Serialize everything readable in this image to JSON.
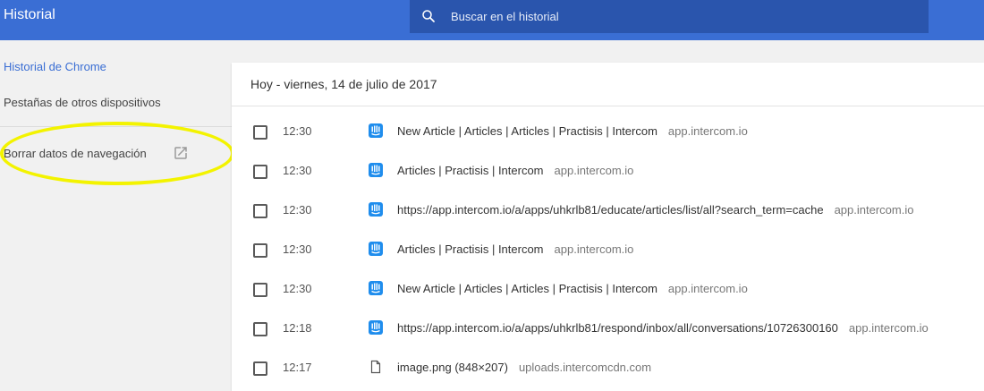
{
  "header": {
    "title": "Historial",
    "search_placeholder": "Buscar en el historial"
  },
  "sidebar": {
    "items": [
      {
        "label": "Historial de Chrome",
        "active": true
      },
      {
        "label": "Pestañas de otros dispositivos"
      },
      {
        "label": "Borrar datos de navegación"
      }
    ]
  },
  "history": {
    "date_header": "Hoy - viernes, 14 de julio de 2017",
    "entries": [
      {
        "time": "12:30",
        "title": "New Article | Articles | Articles | Practisis | Intercom",
        "domain": "app.intercom.io",
        "icon": "intercom-icon"
      },
      {
        "time": "12:30",
        "title": "Articles | Practisis | Intercom",
        "domain": "app.intercom.io",
        "icon": "intercom-icon"
      },
      {
        "time": "12:30",
        "title": "https://app.intercom.io/a/apps/uhkrlb81/educate/articles/list/all?search_term=cache",
        "domain": "app.intercom.io",
        "icon": "intercom-icon"
      },
      {
        "time": "12:30",
        "title": "Articles | Practisis | Intercom",
        "domain": "app.intercom.io",
        "icon": "intercom-icon"
      },
      {
        "time": "12:30",
        "title": "New Article | Articles | Articles | Practisis | Intercom",
        "domain": "app.intercom.io",
        "icon": "intercom-icon"
      },
      {
        "time": "12:18",
        "title": "https://app.intercom.io/a/apps/uhkrlb81/respond/inbox/all/conversations/10726300160",
        "domain": "app.intercom.io",
        "icon": "intercom-icon"
      },
      {
        "time": "12:17",
        "title": "image.png (848×207)",
        "domain": "uploads.intercomcdn.com",
        "icon": "file-icon"
      }
    ]
  },
  "colors": {
    "header": "#3a6ed4",
    "search_box": "#2a55ad",
    "accent": "#3a6ed4",
    "intercom": "#1f8ded",
    "highlight": "#f3f300"
  }
}
